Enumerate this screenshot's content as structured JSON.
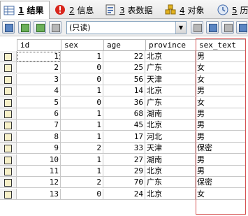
{
  "tabs": [
    {
      "num": "1",
      "label": "结果",
      "active": true,
      "icon": "grid-result-icon"
    },
    {
      "num": "2",
      "label": "信息",
      "active": false,
      "icon": "info-icon"
    },
    {
      "num": "3",
      "label": "表数据",
      "active": false,
      "icon": "table-data-icon"
    },
    {
      "num": "4",
      "label": "对象",
      "active": false,
      "icon": "objects-icon"
    },
    {
      "num": "5",
      "label": "历",
      "active": false,
      "icon": "history-icon"
    }
  ],
  "toolbar": {
    "mode_select_value": "(只读)"
  },
  "grid": {
    "columns": [
      "id",
      "sex",
      "age",
      "province",
      "sex_text"
    ],
    "rows": [
      {
        "id": "1",
        "sex": "1",
        "age": "22",
        "province": "北京",
        "sex_text": "男"
      },
      {
        "id": "2",
        "sex": "0",
        "age": "25",
        "province": "广东",
        "sex_text": "女"
      },
      {
        "id": "3",
        "sex": "0",
        "age": "56",
        "province": "天津",
        "sex_text": "女"
      },
      {
        "id": "4",
        "sex": "1",
        "age": "14",
        "province": "北京",
        "sex_text": "男"
      },
      {
        "id": "5",
        "sex": "0",
        "age": "36",
        "province": "广东",
        "sex_text": "女"
      },
      {
        "id": "6",
        "sex": "1",
        "age": "68",
        "province": "湖南",
        "sex_text": "男"
      },
      {
        "id": "7",
        "sex": "1",
        "age": "45",
        "province": "北京",
        "sex_text": "男"
      },
      {
        "id": "8",
        "sex": "1",
        "age": "17",
        "province": "河北",
        "sex_text": "男"
      },
      {
        "id": "9",
        "sex": "2",
        "age": "33",
        "province": "天津",
        "sex_text": "保密"
      },
      {
        "id": "10",
        "sex": "1",
        "age": "27",
        "province": "湖南",
        "sex_text": "男"
      },
      {
        "id": "11",
        "sex": "1",
        "age": "29",
        "province": "北京",
        "sex_text": "男"
      },
      {
        "id": "12",
        "sex": "2",
        "age": "70",
        "province": "广东",
        "sex_text": "保密"
      },
      {
        "id": "13",
        "sex": "0",
        "age": "24",
        "province": "北京",
        "sex_text": "女"
      }
    ]
  }
}
